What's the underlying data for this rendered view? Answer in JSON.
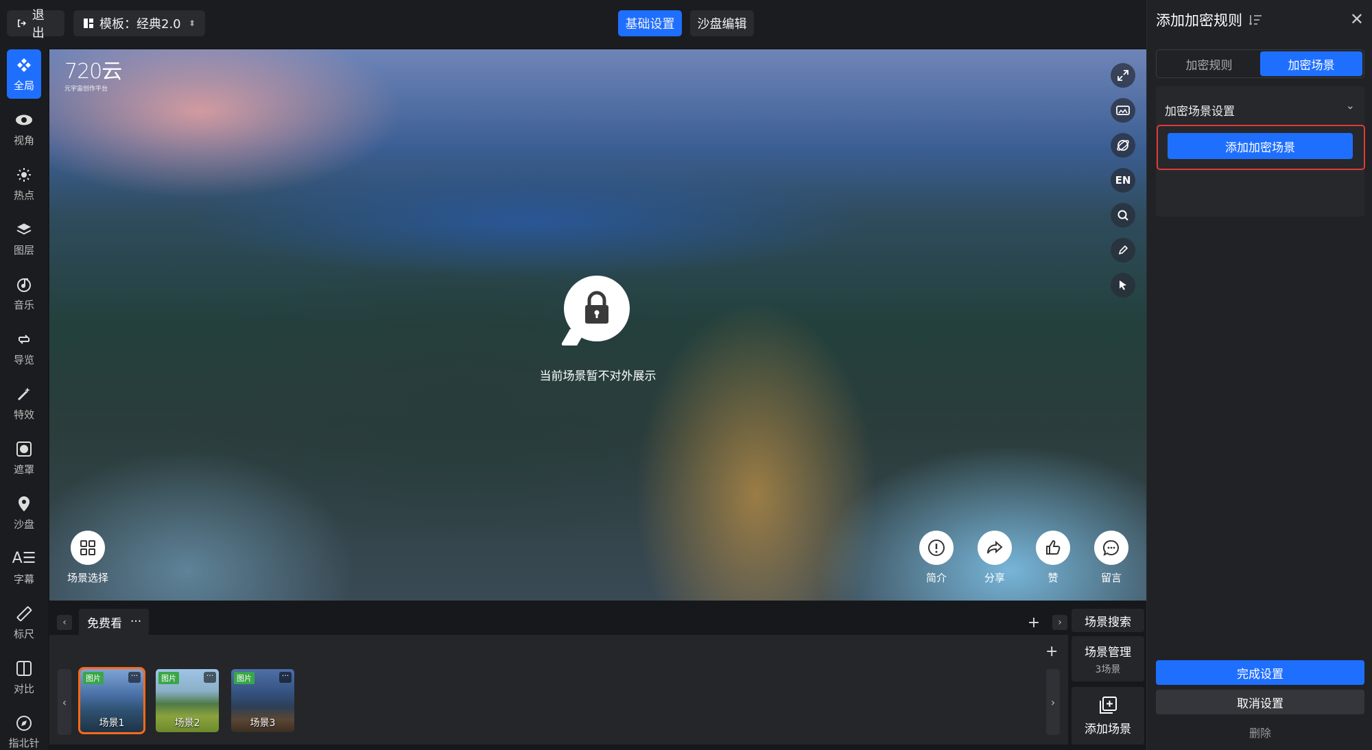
{
  "topbar": {
    "exit_label": "退出",
    "template_label": "模板：经典2.0",
    "tab_basic": "基础设置",
    "tab_sandtable": "沙盘编辑"
  },
  "sidebar": {
    "items": [
      {
        "label": "全局",
        "icon": "global-icon",
        "active": true
      },
      {
        "label": "视角",
        "icon": "eye-icon"
      },
      {
        "label": "热点",
        "icon": "hotspot-icon"
      },
      {
        "label": "图层",
        "icon": "layers-icon"
      },
      {
        "label": "音乐",
        "icon": "music-icon"
      },
      {
        "label": "导览",
        "icon": "tour-icon"
      },
      {
        "label": "特效",
        "icon": "magic-wand-icon"
      },
      {
        "label": "遮罩",
        "icon": "mask-icon"
      },
      {
        "label": "沙盘",
        "icon": "map-pin-icon"
      },
      {
        "label": "字幕",
        "icon": "subtitle-icon"
      },
      {
        "label": "标尺",
        "icon": "ruler-icon"
      },
      {
        "label": "对比",
        "icon": "compare-icon"
      },
      {
        "label": "指北针",
        "icon": "compass-icon"
      }
    ]
  },
  "viewer": {
    "logo_main": "720云",
    "logo_sub": "元宇宙创作平台",
    "lock_message": "当前场景暂不对外展示",
    "right_tools": [
      "fullscreen-icon",
      "vr-icon",
      "gyroscope-icon",
      "EN",
      "search-icon",
      "edit-icon",
      "cursor-icon"
    ],
    "scene_select_label": "场景选择",
    "actions": [
      {
        "label": "简介",
        "icon": "info-icon"
      },
      {
        "label": "分享",
        "icon": "share-icon"
      },
      {
        "label": "赞",
        "icon": "thumbs-up-icon"
      },
      {
        "label": "留言",
        "icon": "comment-icon"
      }
    ]
  },
  "strip": {
    "group_tab": "免费看",
    "group_more": "···",
    "scenes": [
      {
        "label": "场景1",
        "tag": "图片",
        "selected": true
      },
      {
        "label": "场景2",
        "tag": "图片"
      },
      {
        "label": "场景3",
        "tag": "图片"
      }
    ],
    "scene_search": "场景搜索",
    "scene_manage": "场景管理",
    "scene_count": "3场景",
    "add_scene": "添加场景"
  },
  "panel": {
    "title": "添加加密规则",
    "tabs": [
      {
        "label": "加密规则"
      },
      {
        "label": "加密场景",
        "active": true
      }
    ],
    "section_title": "加密场景设置",
    "add_button": "添加加密场景",
    "done_button": "完成设置",
    "cancel_button": "取消设置",
    "delete_link": "删除"
  },
  "colors": {
    "accent": "#1f6fff",
    "highlight_border": "#e23b36",
    "selected_thumb": "#ff6a1a"
  }
}
